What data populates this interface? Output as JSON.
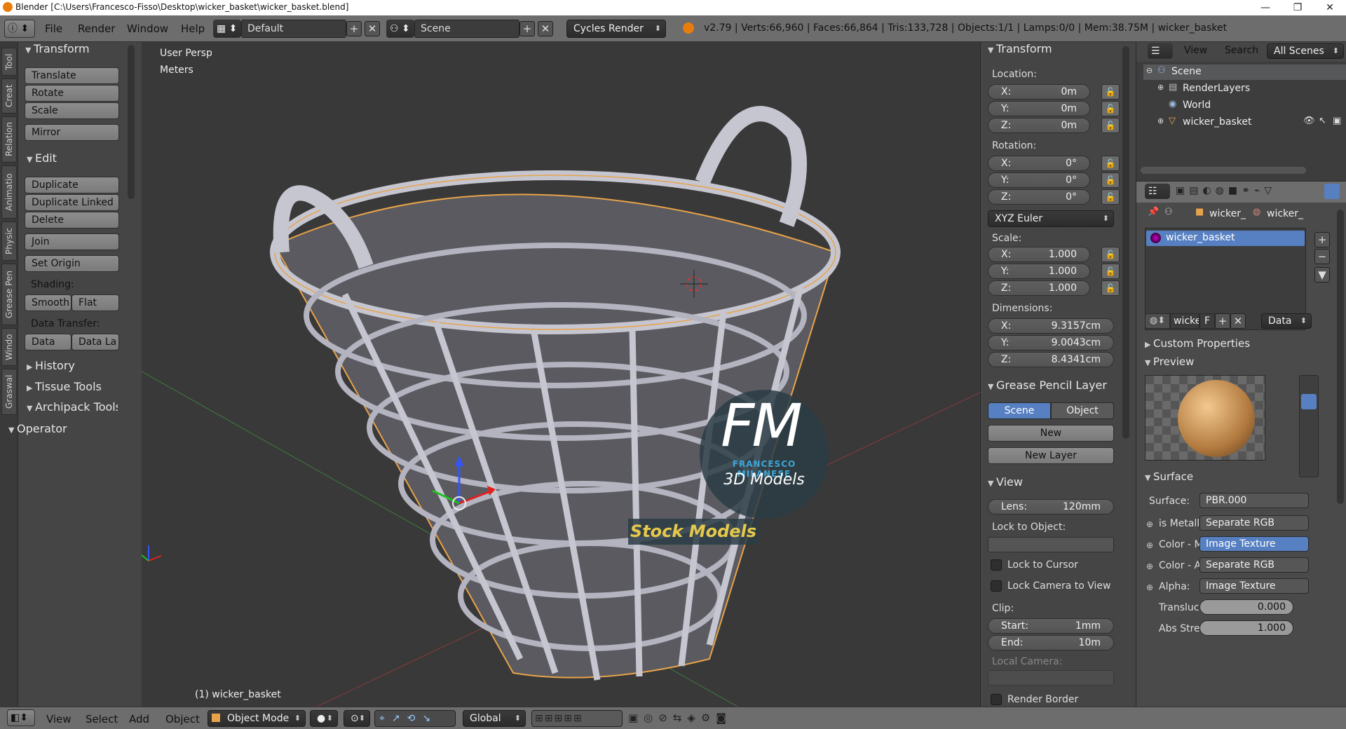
{
  "window": {
    "title": "Blender [C:\\Users\\Francesco-Fisso\\Desktop\\wicker_basket\\wicker_basket.blend]",
    "minimize": "—",
    "maximize": "❐",
    "close": "✕"
  },
  "header": {
    "menus": [
      "File",
      "Render",
      "Window",
      "Help"
    ],
    "layout": "Default",
    "scene": "Scene",
    "engine": "Cycles Render",
    "stats": "v2.79 | Verts:66,960 | Faces:66,864 | Tris:133,728 | Objects:1/1 | Lamps:0/0 | Mem:38.75M | wicker_basket"
  },
  "tabs": [
    "Tool",
    "Creat",
    "Relation",
    "Animatio",
    "Physic",
    "Grease Pen",
    "Windo",
    "Graswal"
  ],
  "toolshelf": {
    "transform": {
      "title": "Transform",
      "buttons": [
        "Translate",
        "Rotate",
        "Scale",
        "Mirror"
      ]
    },
    "edit": {
      "title": "Edit",
      "buttons": [
        "Duplicate",
        "Duplicate Linked",
        "Delete",
        "Join"
      ],
      "set_origin": "Set Origin",
      "shading_label": "Shading:",
      "smooth": "Smooth",
      "flat": "Flat",
      "data_transfer_label": "Data Transfer:",
      "data": "Data",
      "data_la": "Data La"
    },
    "history": "History",
    "tissue": "Tissue Tools",
    "archipack": "Archipack Tools",
    "operator": "Operator"
  },
  "viewport": {
    "view_name": "User Persp",
    "units": "Meters",
    "object_label": "(1) wicker_basket",
    "watermark": {
      "logo": "FM",
      "author": "FRANCESCO MILANESE",
      "subtitle": "3D Models",
      "banner": "Stock Models"
    }
  },
  "npanel": {
    "transform_title": "Transform",
    "location_label": "Location:",
    "location": [
      {
        "k": "X:",
        "v": "0m"
      },
      {
        "k": "Y:",
        "v": "0m"
      },
      {
        "k": "Z:",
        "v": "0m"
      }
    ],
    "rotation_label": "Rotation:",
    "rotation": [
      {
        "k": "X:",
        "v": "0°"
      },
      {
        "k": "Y:",
        "v": "0°"
      },
      {
        "k": "Z:",
        "v": "0°"
      }
    ],
    "rotation_mode": "XYZ Euler",
    "scale_label": "Scale:",
    "scale": [
      {
        "k": "X:",
        "v": "1.000"
      },
      {
        "k": "Y:",
        "v": "1.000"
      },
      {
        "k": "Z:",
        "v": "1.000"
      }
    ],
    "dimensions_label": "Dimensions:",
    "dimensions": [
      {
        "k": "X:",
        "v": "9.3157cm"
      },
      {
        "k": "Y:",
        "v": "9.0043cm"
      },
      {
        "k": "Z:",
        "v": "8.4341cm"
      }
    ],
    "grease_title": "Grease Pencil Layer",
    "grease_scene": "Scene",
    "grease_object": "Object",
    "grease_new": "New",
    "grease_new_layer": "New Layer",
    "view_title": "View",
    "lens": {
      "k": "Lens:",
      "v": "120mm"
    },
    "lock_object_label": "Lock to Object:",
    "lock_cursor": "Lock to Cursor",
    "lock_camera": "Lock Camera to View",
    "clip_label": "Clip:",
    "clip_start": {
      "k": "Start:",
      "v": "1mm"
    },
    "clip_end": {
      "k": "End:",
      "v": "10m"
    },
    "local_camera_label": "Local Camera:",
    "render_border": "Render Border"
  },
  "outliner": {
    "view": "View",
    "search": "Search",
    "filter": "All Scenes",
    "items": [
      "Scene",
      "RenderLayers",
      "World",
      "wicker_basket"
    ]
  },
  "properties": {
    "breadcrumb": [
      "wicker_",
      "wicker_"
    ],
    "material": "wicker_basket",
    "mat_name": "wicke",
    "mat_f": "F",
    "link": "Data",
    "custom_props": "Custom Properties",
    "preview": "Preview",
    "surface_title": "Surface",
    "surface_label": "Surface:",
    "surface_value": "PBR.000",
    "inputs": [
      {
        "k": "is Metallic",
        "v": "Separate RGB"
      },
      {
        "k": "Color - Ma",
        "v": "Image Texture"
      },
      {
        "k": "Color - Ab",
        "v": "Separate RGB"
      },
      {
        "k": "Alpha:",
        "v": "Image Texture"
      }
    ],
    "translucency": {
      "k": "Transluce",
      "v": "0.000"
    },
    "abs_strength": {
      "k": "Abs Stren",
      "v": "1.000"
    }
  },
  "bottombar": {
    "menus": [
      "View",
      "Select",
      "Add",
      "Object"
    ],
    "mode": "Object Mode",
    "orientation": "Global"
  },
  "colors": {
    "accent": "#5680c2",
    "selection_outline": "#e8a34a",
    "basket": "#b4b4c0"
  }
}
